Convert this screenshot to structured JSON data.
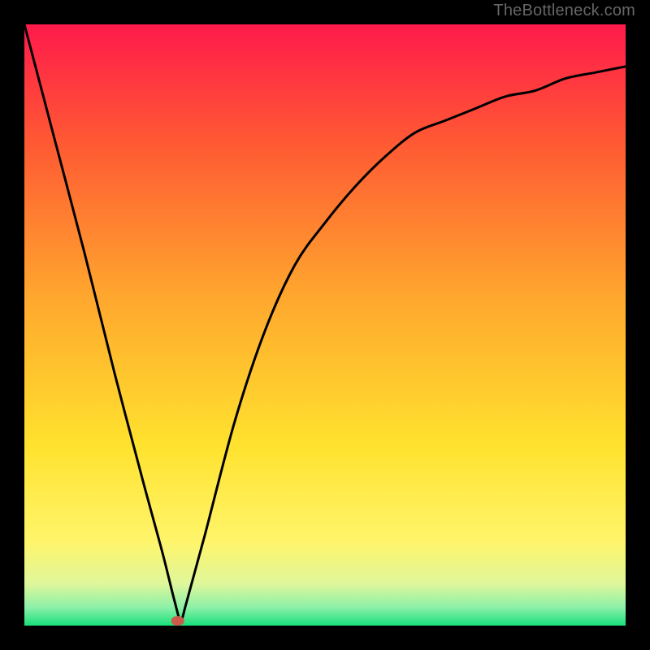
{
  "watermark": "TheBottleneck.com",
  "chart_data": {
    "type": "line",
    "title": "",
    "xlabel": "",
    "ylabel": "",
    "xlim": [
      0,
      100
    ],
    "ylim": [
      0,
      100
    ],
    "grid": false,
    "series": [
      {
        "name": "bottleneck-curve",
        "x": [
          0,
          5,
          10,
          15,
          20,
          23,
          25,
          26,
          27,
          30,
          35,
          40,
          45,
          50,
          55,
          60,
          65,
          70,
          75,
          80,
          85,
          90,
          95,
          100
        ],
        "y": [
          100,
          81,
          62,
          42,
          23,
          12,
          4,
          1,
          4,
          15,
          34,
          49,
          60,
          67,
          73,
          78,
          82,
          84,
          86,
          88,
          89,
          91,
          92,
          93
        ]
      }
    ],
    "marker": {
      "name": "optimal-point",
      "x": 25.5,
      "y": 0.8,
      "color": "#cc5a4a"
    },
    "background_gradient": {
      "stops": [
        {
          "offset": 0.0,
          "color": "#ff1a4b"
        },
        {
          "offset": 0.2,
          "color": "#ff5a33"
        },
        {
          "offset": 0.45,
          "color": "#ffa62e"
        },
        {
          "offset": 0.7,
          "color": "#ffe22e"
        },
        {
          "offset": 0.86,
          "color": "#fff56b"
        },
        {
          "offset": 0.93,
          "color": "#dff79a"
        },
        {
          "offset": 0.97,
          "color": "#8cf0a8"
        },
        {
          "offset": 1.0,
          "color": "#18e07a"
        }
      ]
    }
  }
}
